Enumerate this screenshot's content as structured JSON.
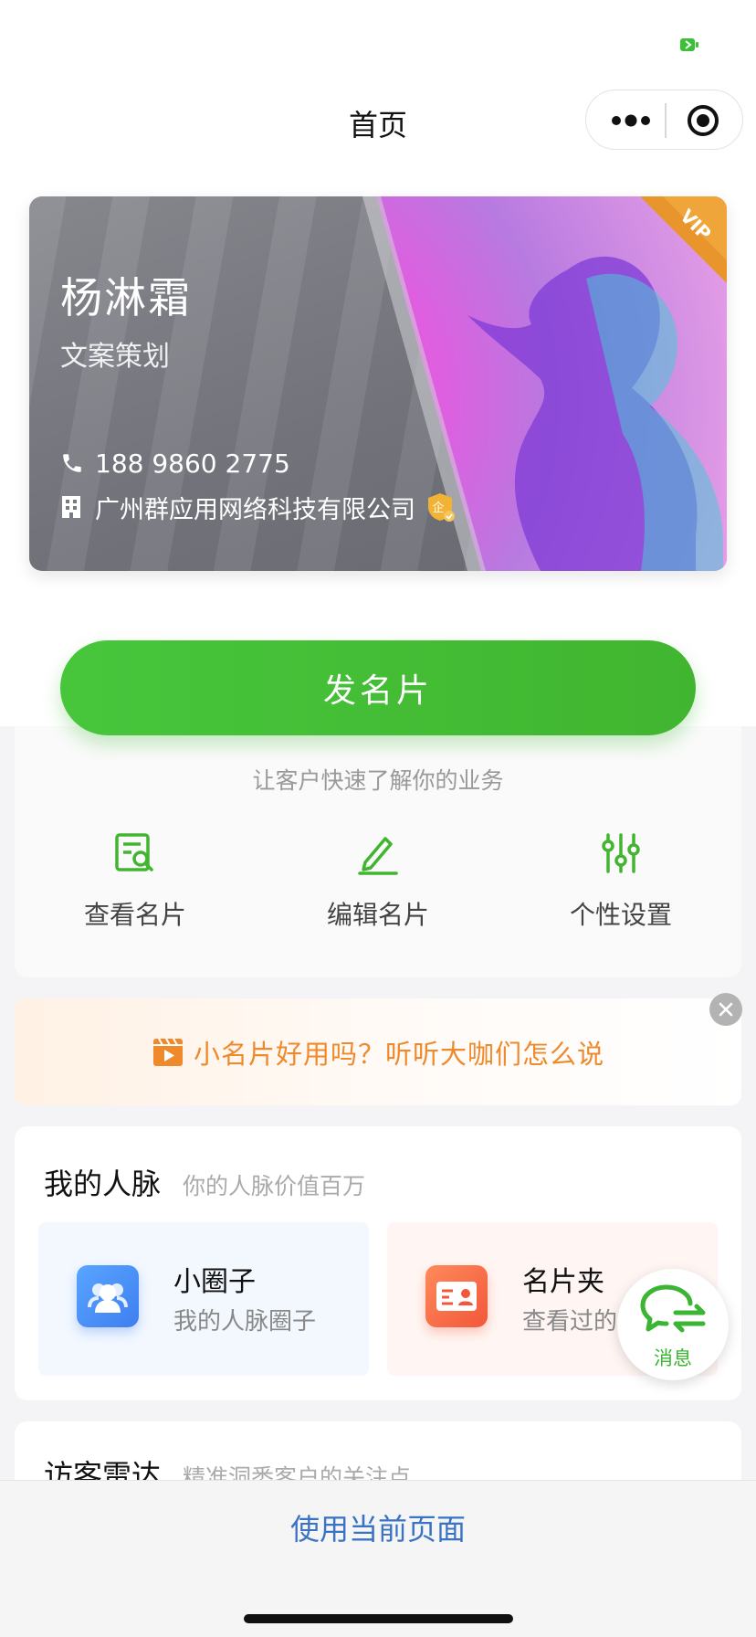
{
  "nav": {
    "title": "首页"
  },
  "card": {
    "name": "杨淋霜",
    "job_title": "文案策划",
    "phone": "188 9860 2775",
    "company": "广州群应用网络科技有限公司",
    "vip_label": "VIP",
    "verified_badge": "企"
  },
  "actions": {
    "send_label": "发名片",
    "subtitle": "让客户快速了解你的业务",
    "items": [
      {
        "label": "查看名片",
        "icon": "view-card-icon"
      },
      {
        "label": "编辑名片",
        "icon": "pen-icon"
      },
      {
        "label": "个性设置",
        "icon": "sliders-icon"
      }
    ]
  },
  "promo": {
    "text": "小名片好用吗？听听大咖们怎么说"
  },
  "network": {
    "title": "我的人脉",
    "subtitle": "你的人脉价值百万",
    "tiles": [
      {
        "title": "小圈子",
        "subtitle": "我的人脉圈子",
        "icon": "people-icon"
      },
      {
        "title": "名片夹",
        "subtitle": "查看过的名片",
        "icon": "card-holder-icon"
      }
    ]
  },
  "message_fab": {
    "label": "消息"
  },
  "radar": {
    "title": "访客雷达",
    "subtitle": "精准洞悉客户的关注点"
  },
  "bottom": {
    "use_page_label": "使用当前页面"
  },
  "colors": {
    "brand_green": "#41b52f",
    "promo_orange": "#ef8a2c",
    "link_blue": "#3a72c4"
  }
}
